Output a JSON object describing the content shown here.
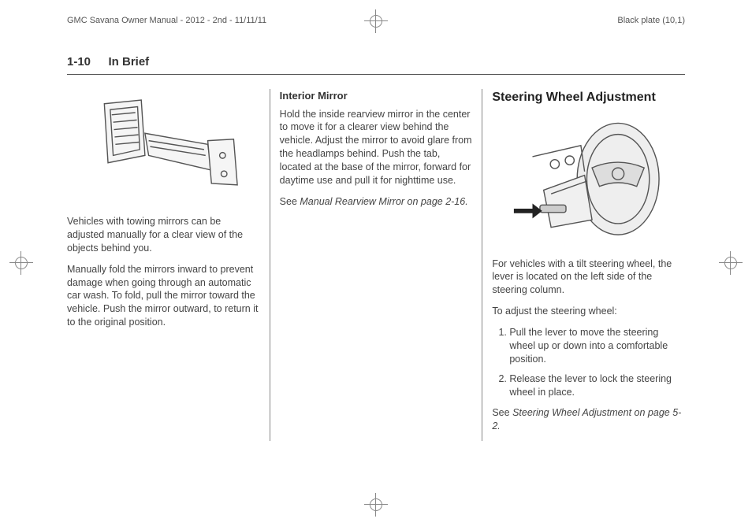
{
  "header": {
    "doc_title": "GMC Savana Owner Manual - 2012 - 2nd - 11/11/11",
    "plate": "Black plate (10,1)"
  },
  "page_header": {
    "page_num": "1-10",
    "section": "In Brief"
  },
  "col1": {
    "p1": "Vehicles with towing mirrors can be adjusted manually for a clear view of the objects behind you.",
    "p2": "Manually fold the mirrors inward to prevent damage when going through an automatic car wash. To fold, pull the mirror toward the vehicle. Push the mirror outward, to return it to the original position."
  },
  "col2": {
    "heading": "Interior Mirror",
    "p1": "Hold the inside rearview mirror in the center to move it for a clearer view behind the vehicle. Adjust the mirror to avoid glare from the headlamps behind. Push the tab, located at the base of the mirror, forward for daytime use and pull it for nighttime use.",
    "see_prefix": "See ",
    "see_ref": "Manual Rearview Mirror on page 2-16."
  },
  "col3": {
    "heading": "Steering Wheel Adjustment",
    "p1": "For vehicles with a tilt steering wheel, the lever is located on the left side of the steering column.",
    "p2": "To adjust the steering wheel:",
    "step1": "Pull the lever to move the steering wheel up or down into a comfortable position.",
    "step2": "Release the lever to lock the steering wheel in place.",
    "see_prefix": "See ",
    "see_ref": "Steering Wheel Adjustment on page 5-2."
  }
}
